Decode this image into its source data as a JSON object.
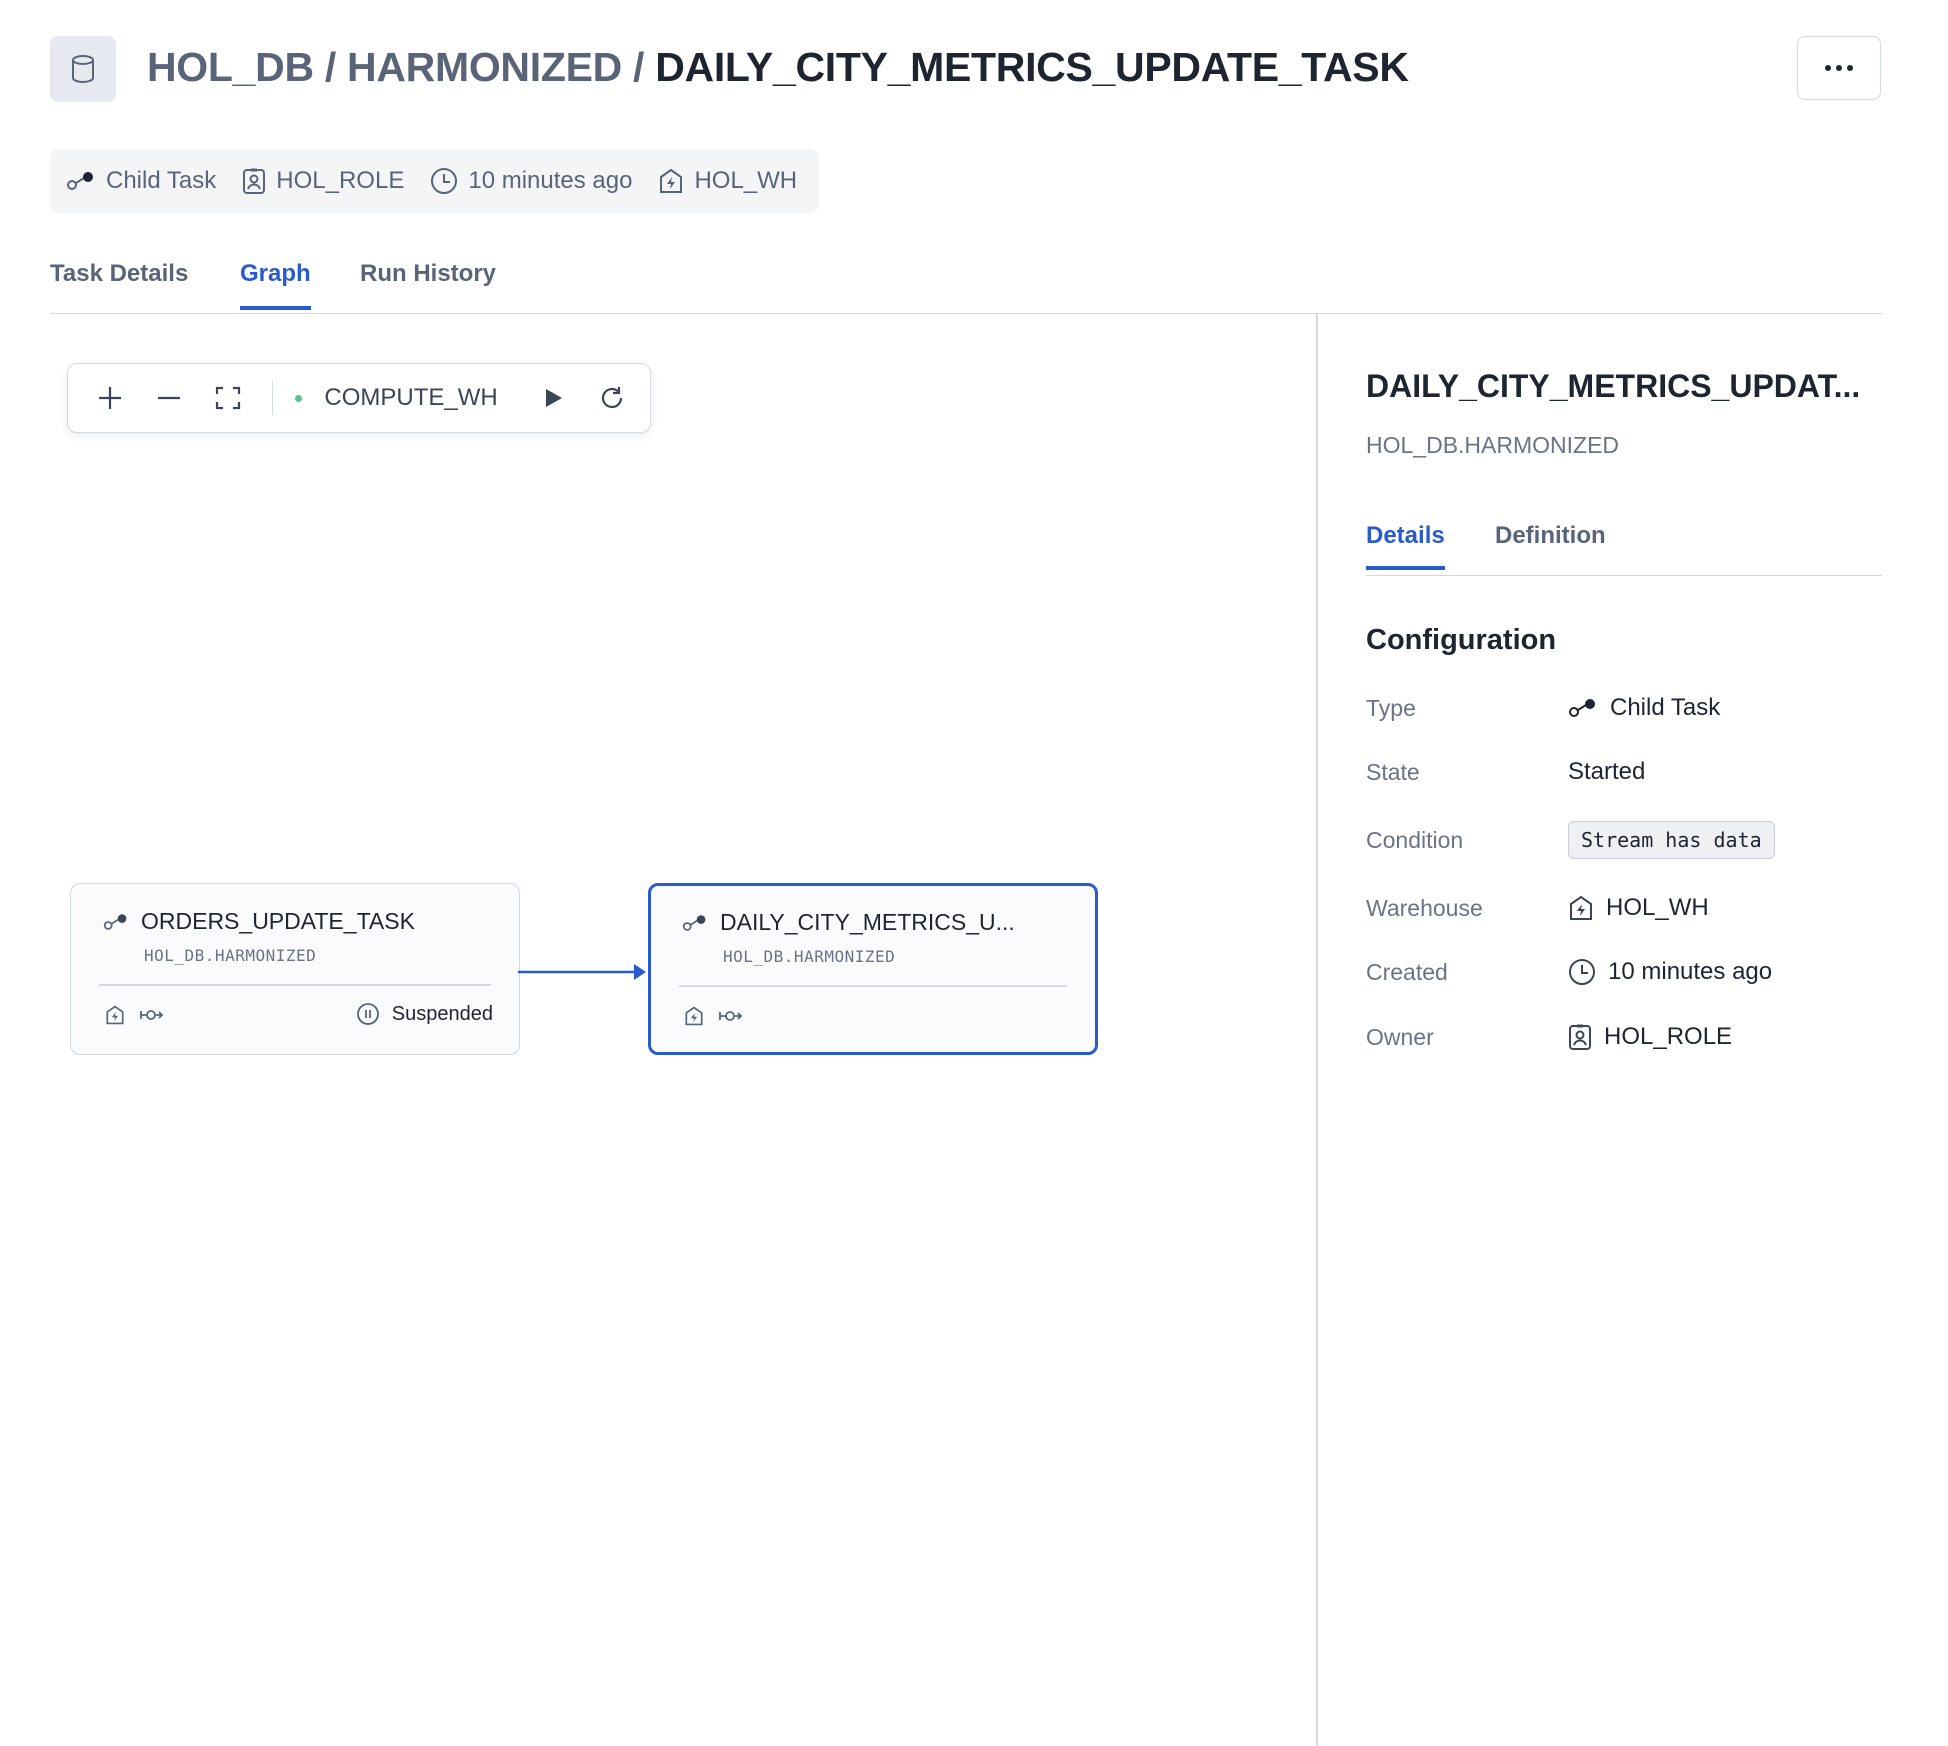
{
  "header": {
    "crumb_db": "HOL_DB",
    "sep1": " / ",
    "crumb_schema": "HARMONIZED",
    "sep2": " / ",
    "current": "DAILY_CITY_METRICS_UPDATE_TASK"
  },
  "meta": {
    "type": "Child Task",
    "role": "HOL_ROLE",
    "time": "10 minutes ago",
    "warehouse": "HOL_WH"
  },
  "tabs": [
    {
      "label": "Task Details"
    },
    {
      "label": "Graph"
    },
    {
      "label": "Run History"
    }
  ],
  "toolbar": {
    "warehouse": "COMPUTE_WH"
  },
  "graph": {
    "nodes": [
      {
        "name": "ORDERS_UPDATE_TASK",
        "schema": "HOL_DB.HARMONIZED",
        "status": "Suspended"
      },
      {
        "name": "DAILY_CITY_METRICS_U...",
        "schema": "HOL_DB.HARMONIZED"
      }
    ]
  },
  "panel": {
    "title": "DAILY_CITY_METRICS_UPDAT...",
    "subtitle": "HOL_DB.HARMONIZED",
    "tabs": [
      {
        "label": "Details"
      },
      {
        "label": "Definition"
      }
    ],
    "section": "Configuration",
    "rows": [
      {
        "key": "Type",
        "value": "Child Task"
      },
      {
        "key": "State",
        "value": "Started"
      },
      {
        "key": "Condition",
        "value": "Stream has data"
      },
      {
        "key": "Warehouse",
        "value": "HOL_WH"
      },
      {
        "key": "Created",
        "value": "10 minutes ago"
      },
      {
        "key": "Owner",
        "value": "HOL_ROLE"
      }
    ]
  },
  "colors": {
    "accent": "#2a5ad0",
    "status_green": "#5fbf8f"
  }
}
